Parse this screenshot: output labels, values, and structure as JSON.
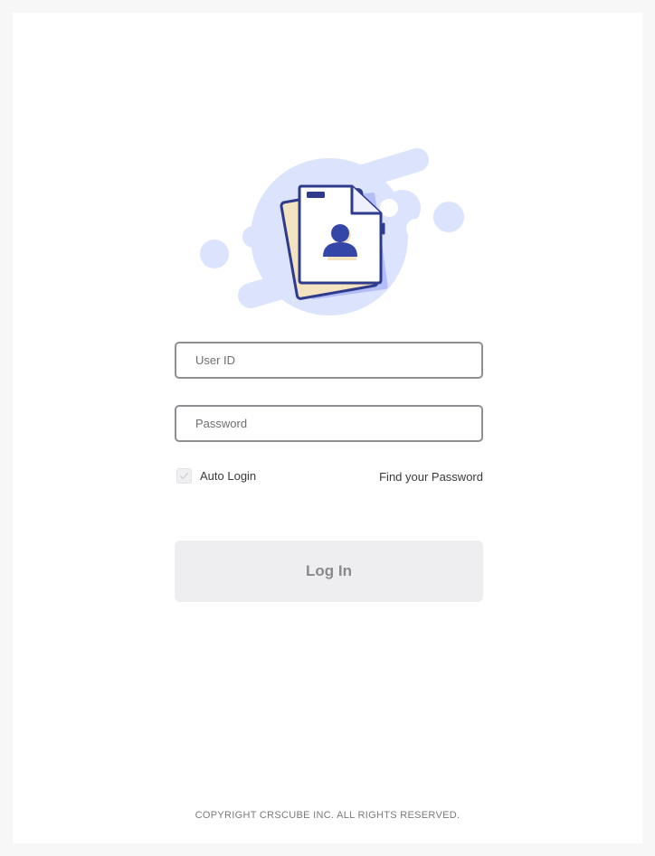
{
  "login": {
    "user_id_placeholder": "User ID",
    "password_placeholder": "Password",
    "auto_login_label": "Auto Login",
    "auto_login_checked": false,
    "find_password_label": "Find your Password",
    "login_button_label": "Log In"
  },
  "footer": {
    "copyright": "COPYRIGHT CRSCUBE INC. ALL RIGHTS RESERVED."
  },
  "colors": {
    "accent": "#2e3a8c",
    "illustration_blob": "#dce3fc",
    "illustration_shadow": "#b3bdf7",
    "illustration_paper_tint": "#f3e3c0",
    "button_bg": "#eeeef0",
    "button_text": "#8a8a8e",
    "field_border": "#8f8f93"
  },
  "icons": {
    "illustration": "document-profile-illustration",
    "checkbox": "check-icon"
  }
}
